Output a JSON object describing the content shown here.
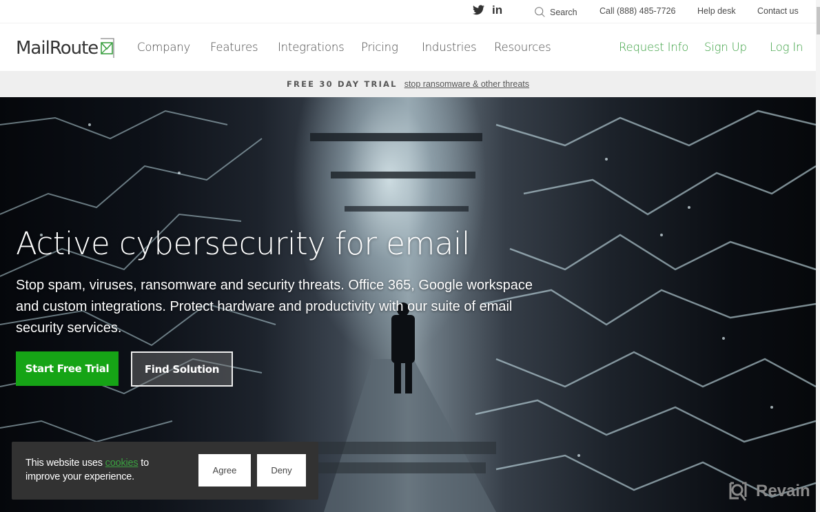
{
  "topbar": {
    "social": [
      {
        "icon": "twitter-icon"
      },
      {
        "icon": "linkedin-icon",
        "label": "in"
      }
    ],
    "search_label": "Search",
    "call_label": "Call (888) 485-7726",
    "help_label": "Help desk",
    "contact_label": "Contact us"
  },
  "nav": {
    "logo_text": "MailRoute",
    "links": [
      "Company",
      "Features",
      "Integrations",
      "Pricing",
      "Industries",
      "Resources"
    ],
    "actions": [
      "Request Info",
      "Sign Up",
      "Log In"
    ],
    "accent_color": "#3aa040"
  },
  "promo": {
    "label": "FREE 30 DAY TRIAL",
    "link": "stop ransomware & other threats"
  },
  "hero": {
    "title": "Active cybersecurity for email",
    "subtitle": "Stop spam, viruses, ransomware and security threats. Office 365, Google workspace and custom integrations. Protect hardware and productivity with our suite of email security services.",
    "primary_button": "Start Free Trial",
    "secondary_button": "Find Solution",
    "primary_color": "#16a416"
  },
  "cookie": {
    "text_before": "This website uses ",
    "link": "cookies",
    "text_after": " to improve your experience.",
    "agree": "Agree",
    "deny": "Deny"
  },
  "watermark": {
    "label": "Revain"
  }
}
